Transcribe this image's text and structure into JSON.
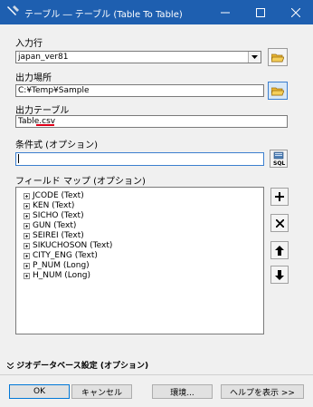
{
  "window": {
    "title": "テーブル ― テーブル (Table To Table)",
    "minimize_icon": "minimize-icon",
    "maximize_icon": "maximize-icon",
    "close_icon": "close-icon"
  },
  "fields": {
    "input_row": {
      "label": "入力行",
      "value": "japan_ver81"
    },
    "output_location": {
      "label": "出力場所",
      "value": "C:¥Temp¥Sample"
    },
    "output_table": {
      "label": "出力テーブル",
      "value": "Table.csv"
    },
    "expression": {
      "label": "条件式 (オプション)",
      "value": "",
      "sql_label": "SQL"
    }
  },
  "field_map": {
    "label": "フィールド マップ (オプション)",
    "items": [
      "JCODE (Text)",
      "KEN (Text)",
      "SICHO (Text)",
      "GUN (Text)",
      "SEIREI (Text)",
      "SIKUCHOSON (Text)",
      "CITY_ENG (Text)",
      "P_NUM (Long)",
      "H_NUM (Long)"
    ]
  },
  "environment": {
    "label": "ジオデータベース設定 (オプション)"
  },
  "buttons": {
    "ok": "OK",
    "cancel": "キャンセル",
    "environments": "環境...",
    "help": "ヘルプを表示 >>"
  },
  "colors": {
    "titlebar": "#1e5fb0",
    "accent_underline": "#e0001a"
  }
}
